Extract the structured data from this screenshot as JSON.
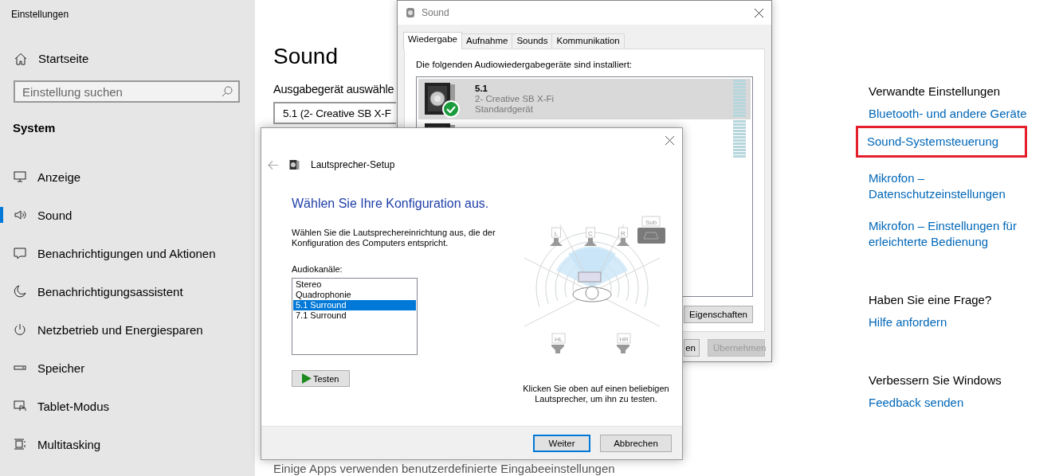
{
  "settings": {
    "app_title": "Einstellungen",
    "home": "Startseite",
    "search": {
      "placeholder": "Einstellung suchen"
    },
    "section": "System",
    "nav": [
      {
        "label": "Anzeige",
        "selected": false
      },
      {
        "label": "Sound",
        "selected": true
      },
      {
        "label": "Benachrichtigungen und Aktionen",
        "selected": false
      },
      {
        "label": "Benachrichtigungsassistent",
        "selected": false
      },
      {
        "label": "Netzbetrieb und Energiesparen",
        "selected": false
      },
      {
        "label": "Speicher",
        "selected": false
      },
      {
        "label": "Tablet-Modus",
        "selected": false
      },
      {
        "label": "Multitasking",
        "selected": false
      }
    ]
  },
  "page": {
    "title": "Sound",
    "output_label": "Ausgabegerät auswähle",
    "output_device": "5.1 (2- Creative SB X-F",
    "footer_text": "Einige Apps verwenden benutzerdefinierte Eingabeeinstellungen"
  },
  "related": {
    "groups": [
      {
        "heading": "Verwandte Einstellungen",
        "links": [
          {
            "label": "Bluetooth- und andere Geräte",
            "highlighted": false
          },
          {
            "label": "Sound-Systemsteuerung",
            "highlighted": true
          },
          {
            "label": "Mikrofon – Datenschutzeinstellungen",
            "highlighted": false
          },
          {
            "label": "Mikrofon – Einstellungen für erleichterte Bedienung",
            "highlighted": false
          }
        ]
      },
      {
        "heading": "Haben Sie eine Frage?",
        "links": [
          {
            "label": "Hilfe anfordern",
            "highlighted": false
          }
        ]
      },
      {
        "heading": "Verbessern Sie Windows",
        "links": [
          {
            "label": "Feedback senden",
            "highlighted": false
          }
        ]
      }
    ]
  },
  "sound_dialog": {
    "title": "Sound",
    "tabs": [
      {
        "label": "Wiedergabe",
        "selected": true
      },
      {
        "label": "Aufnahme",
        "selected": false
      },
      {
        "label": "Sounds",
        "selected": false
      },
      {
        "label": "Kommunikation",
        "selected": false
      }
    ],
    "intro": "Die folgenden Audiowiedergabegeräte sind installiert:",
    "devices": [
      {
        "name": "5.1",
        "detail": "2- Creative SB X-Fi",
        "status": "Standardgerät",
        "default": true,
        "selected": true
      },
      {
        "selected": false
      }
    ],
    "panel_buttons": [
      {
        "label": "Eigenschaften",
        "disabled": false
      }
    ],
    "footer_buttons": [
      {
        "label": "en",
        "disabled": false
      },
      {
        "label": "Übernehmen",
        "disabled": true
      }
    ]
  },
  "speaker_setup": {
    "title": "Lautsprecher-Setup",
    "heading": "Wählen Sie Ihre Konfiguration aus.",
    "description": "Wählen Sie die Lautsprechereinrichtung aus, die der Konfiguration des Computers entspricht.",
    "channels_label": "Audiokanäle:",
    "channels": [
      {
        "label": "Stereo",
        "selected": false
      },
      {
        "label": "Quadrophonie",
        "selected": false
      },
      {
        "label": "5.1 Surround",
        "selected": true
      },
      {
        "label": "7.1 Surround",
        "selected": false
      }
    ],
    "test_button": "Testen",
    "hint": "Klicken Sie oben auf einen beliebigen Lautsprecher, um ihn zu testen.",
    "speakers": [
      {
        "label": "L",
        "kind": "front"
      },
      {
        "label": "C",
        "kind": "front"
      },
      {
        "label": "R",
        "kind": "front"
      },
      {
        "label": "Sub",
        "kind": "sub"
      },
      {
        "label": "HL",
        "kind": "rear"
      },
      {
        "label": "HR",
        "kind": "rear"
      }
    ],
    "buttons": [
      {
        "label": "Weiter",
        "default": true
      },
      {
        "label": "Abbrechen",
        "default": false
      }
    ]
  }
}
